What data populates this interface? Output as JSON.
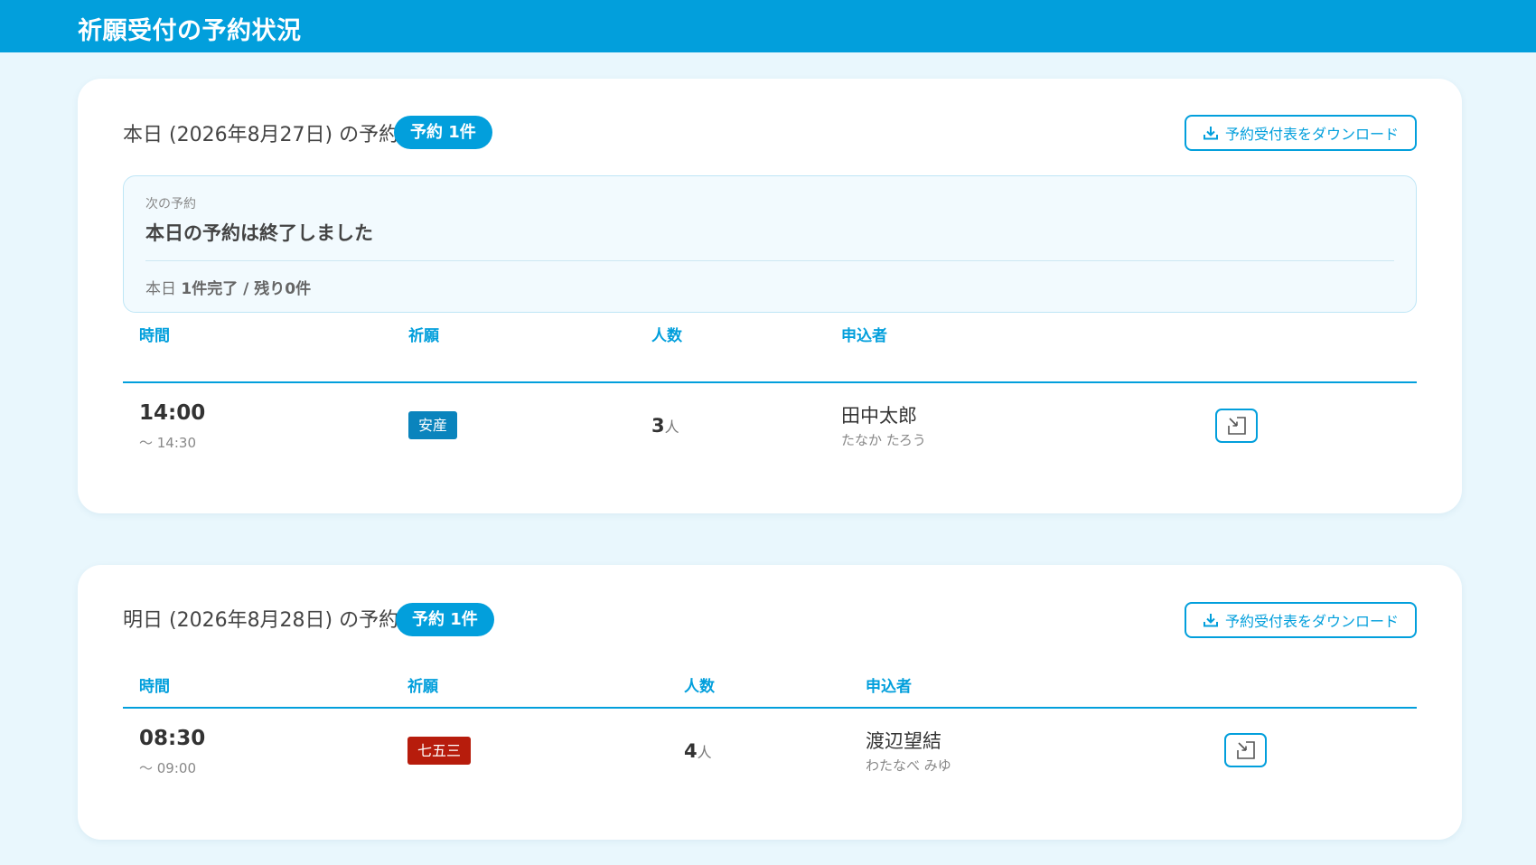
{
  "header": {
    "title": "祈願受付の予約状況"
  },
  "colors": {
    "brand": "#029fdc",
    "tag_anzan": "#0a84bd",
    "tag_shichigosan": "#b71c0c"
  },
  "today": {
    "heading": "本日 (2026年8月27日) の予約",
    "badge": "予約 1件",
    "download_label": "予約受付表をダウンロード",
    "next": {
      "label": "次の予約",
      "status": "本日の予約は終了しました",
      "summary_prefix": "本日 ",
      "summary_done": "1件完了 / 残り0件"
    },
    "columns": [
      "時間",
      "祈願",
      "人数",
      "申込者"
    ],
    "rows": [
      {
        "start": "14:00",
        "end": "〜 14:30",
        "prayer": "安産",
        "people": "3",
        "people_unit": "人",
        "name": "田中太郎",
        "kana": "たなか たろう",
        "edit_icon": "edit-icon"
      }
    ]
  },
  "tomorrow": {
    "heading": "明日 (2026年8月28日) の予約",
    "badge": "予約 1件",
    "download_label": "予約受付表をダウンロード",
    "columns": [
      "時間",
      "祈願",
      "人数",
      "申込者"
    ],
    "rows": [
      {
        "start": "08:30",
        "end": "〜 09:00",
        "prayer": "七五三",
        "people": "4",
        "people_unit": "人",
        "name": "渡辺望結",
        "kana": "わたなべ みゆ",
        "edit_icon": "edit-icon"
      }
    ]
  }
}
